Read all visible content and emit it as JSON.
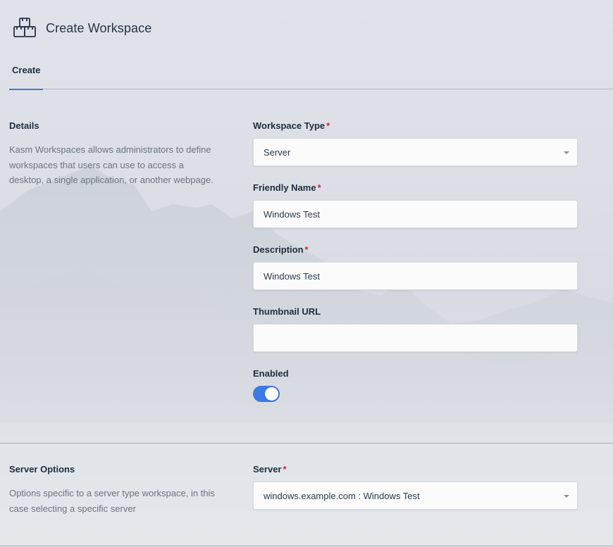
{
  "header": {
    "title": "Create Workspace",
    "icon": "workspace-boxes-icon"
  },
  "tabs": [
    {
      "label": "Create",
      "active": true
    }
  ],
  "details": {
    "title": "Details",
    "description": "Kasm Workspaces allows administrators to define workspaces that users can use to access a desktop, a single application, or another webpage."
  },
  "form": {
    "workspace_type": {
      "label": "Workspace Type",
      "required_mark": "*",
      "value": "Server"
    },
    "friendly_name": {
      "label": "Friendly Name",
      "required_mark": "*",
      "value": "Windows Test"
    },
    "description": {
      "label": "Description",
      "required_mark": "*",
      "value": "Windows Test"
    },
    "thumbnail_url": {
      "label": "Thumbnail URL",
      "value": ""
    },
    "enabled": {
      "label": "Enabled",
      "on": true
    }
  },
  "server_options": {
    "title": "Server Options",
    "description": "Options specific to a server type workspace, in this case selecting a specific server",
    "server": {
      "label": "Server",
      "required_mark": "*",
      "value": "windows.example.com : Windows Test"
    }
  },
  "colors": {
    "accent": "#3d7ae6",
    "required": "#d0263b",
    "tab_underline": "#3f7bd6"
  }
}
